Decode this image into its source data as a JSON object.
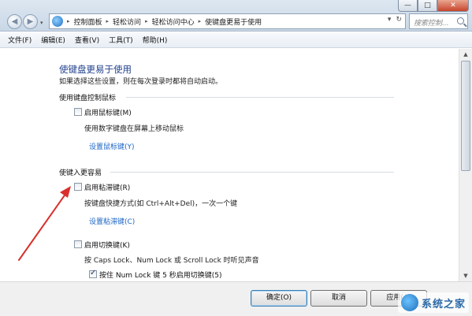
{
  "window": {
    "controls": [
      "—",
      "□",
      "✕"
    ]
  },
  "nav": {
    "back_glyph": "◀",
    "forward_glyph": "▶",
    "recent_glyph": "▾"
  },
  "address": {
    "crumbs": [
      "控制面板",
      "轻松访问",
      "轻松访问中心",
      "使键盘更易于使用"
    ],
    "separator": "▸",
    "dropdown_glyph": "▾",
    "refresh_glyph": "↻"
  },
  "search": {
    "placeholder": "搜索控制..."
  },
  "menu": {
    "items": [
      "文件(F)",
      "编辑(E)",
      "查看(V)",
      "工具(T)",
      "帮助(H)"
    ]
  },
  "page": {
    "title": "使键盘更易于使用",
    "description": "如果选择这些设置，则在每次登录时都将自动启动。"
  },
  "mouse_section": {
    "title": "使用键盘控制鼠标",
    "mouse_keys": {
      "label": "启用鼠标键(M)",
      "checked": false,
      "description": "使用数字键盘在屏幕上移动鼠标",
      "setup_link": "设置鼠标键(Y)"
    }
  },
  "typing_section": {
    "title": "使键入更容易",
    "sticky_keys": {
      "label": "启用粘滞键(R)",
      "checked": false,
      "description": "按键盘快捷方式(如 Ctrl+Alt+Del)，一次一个键",
      "setup_link": "设置粘滞键(C)"
    },
    "toggle_keys": {
      "label": "启用切换键(K)",
      "checked": false,
      "description": "按 Caps Lock、Num Lock 或 Scroll Lock 时听见声音",
      "sub_option": {
        "label": "按住 Num Lock 键 5 秒启用切换键(5)",
        "checked": true
      }
    }
  },
  "footer": {
    "ok": "确定(O)",
    "cancel": "取消",
    "apply": "应用(A)"
  },
  "scrollbar": {
    "up_glyph": "▲",
    "down_glyph": "▼"
  },
  "watermark": {
    "text": "系统之家"
  },
  "colors": {
    "title_blue": "#1e3f8c",
    "link_blue": "#1a64c6",
    "annotation_red": "#d9302c"
  }
}
